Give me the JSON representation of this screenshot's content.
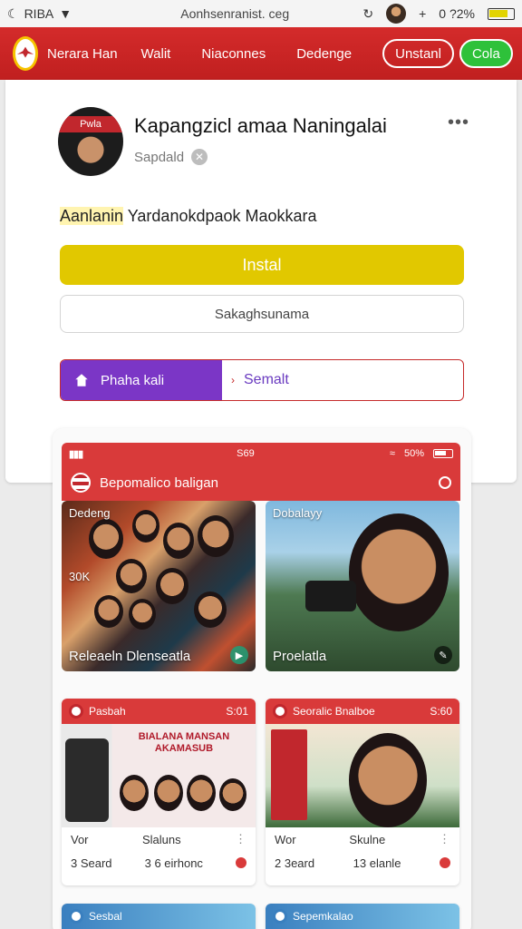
{
  "status_bar": {
    "left_label": "RIBA",
    "url": "Aonhsenranist. ceg",
    "battery_text": "0 ?2%"
  },
  "nav": {
    "links": [
      "Nerara Han",
      "Walit",
      "Niaconnes",
      "Dedenge"
    ],
    "install_label": "Unstanl",
    "cola_label": "Cola"
  },
  "app": {
    "icon_caption": "Pwla",
    "title": "Kapangzicl amaa Naningalai",
    "subtitle": "Sapdald",
    "desc_highlight": "Aanlanin",
    "desc_rest": "Yardanokdpaok Maokkara",
    "install_label": "Instal",
    "secondary_label": "Sakaghsunama",
    "seg_left_label": "Phaha kali",
    "seg_right_label": "Semalt"
  },
  "preview": {
    "status_time": "S69",
    "status_batt": "50%",
    "header_title": "Bepomalico baligan",
    "tile1_label": "Releaeln Dlenseatla",
    "tile1_top": "Dedeng",
    "tile1_mid": "30K",
    "tile2_label": "Proelatla",
    "tile2_top": "Dobalayy",
    "mini1": {
      "title": "Pasbah",
      "time": "S:01",
      "stat1_label": "Vor",
      "stat1_value": "3 Seard",
      "stat2_label": "Slaluns",
      "stat2_value": "3 6 eirhonc"
    },
    "mini2": {
      "title": "Seoralic Bnalboe",
      "time": "S:60",
      "stat1_label": "Wor",
      "stat1_value": "2 3eard",
      "stat2_label": "Skulne",
      "stat2_value": "13 elanle"
    },
    "mini1_poster": "BIALANA MANSAN AKAMASUB",
    "mini3_title": "Sesbal",
    "mini4_title": "Sepemkalao"
  }
}
